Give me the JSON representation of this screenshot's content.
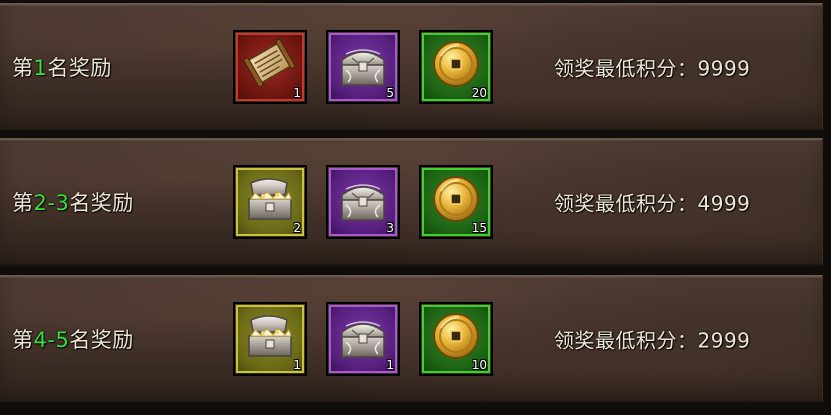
{
  "rewards": [
    {
      "label_prefix": "第",
      "rank": "1",
      "label_suffix": "名奖励",
      "score_label": "领奖最低积分：",
      "score": "9999",
      "items": [
        {
          "icon": "scroll-icon",
          "quality": "red",
          "count": "1"
        },
        {
          "icon": "silver-chest-icon",
          "quality": "purple",
          "count": "5"
        },
        {
          "icon": "gold-coin-icon",
          "quality": "green",
          "count": "20"
        }
      ]
    },
    {
      "label_prefix": "第",
      "rank": "2-3",
      "label_suffix": "名奖励",
      "score_label": "领奖最低积分：",
      "score": "4999",
      "items": [
        {
          "icon": "open-chest-icon",
          "quality": "yellow",
          "count": "2"
        },
        {
          "icon": "silver-chest-icon",
          "quality": "purple",
          "count": "3"
        },
        {
          "icon": "gold-coin-icon",
          "quality": "green",
          "count": "15"
        }
      ]
    },
    {
      "label_prefix": "第",
      "rank": "4-5",
      "label_suffix": "名奖励",
      "score_label": "领奖最低积分：",
      "score": "2999",
      "items": [
        {
          "icon": "open-chest-icon",
          "quality": "yellow",
          "count": "1"
        },
        {
          "icon": "silver-chest-icon",
          "quality": "purple",
          "count": "1"
        },
        {
          "icon": "gold-coin-icon",
          "quality": "green",
          "count": "10"
        }
      ]
    }
  ],
  "colors": {
    "rank_number": "#39e03c",
    "label_text": "#efe6d8",
    "quality_red": "#c43a2d",
    "quality_purple": "#a65ad3",
    "quality_green": "#3fd22c",
    "quality_yellow": "#c8c43c"
  }
}
